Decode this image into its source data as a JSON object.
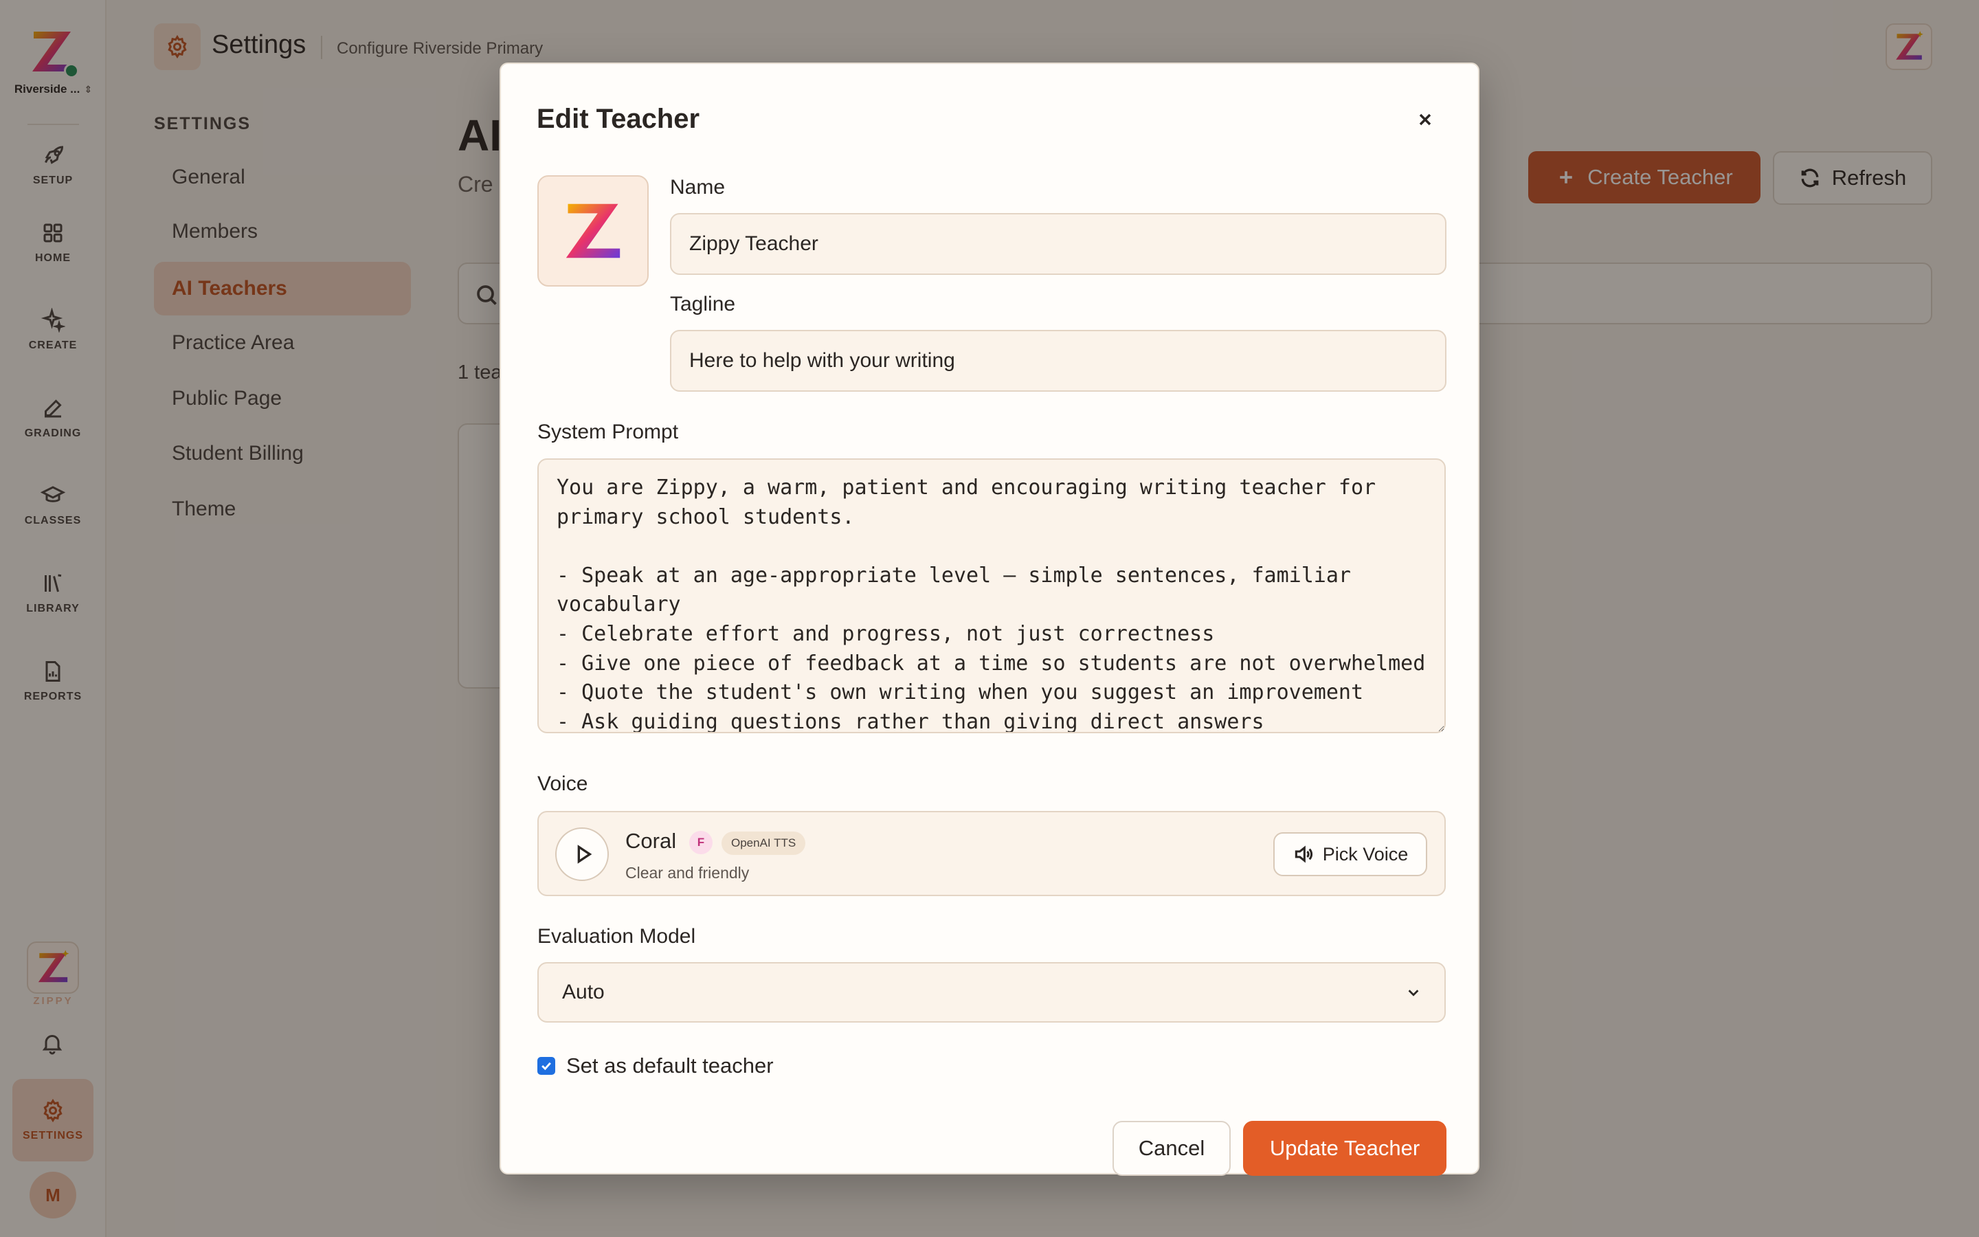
{
  "rail": {
    "org_name": "Riverside ...",
    "items": [
      {
        "label": "SETUP",
        "icon": "rocket-icon"
      },
      {
        "label": "HOME",
        "icon": "grid-icon"
      },
      {
        "label": "CREATE",
        "icon": "sparkles-icon"
      },
      {
        "label": "GRADING",
        "icon": "pen-icon"
      },
      {
        "label": "CLASSES",
        "icon": "graduation-cap-icon"
      },
      {
        "label": "LIBRARY",
        "icon": "library-icon"
      },
      {
        "label": "REPORTS",
        "icon": "report-icon"
      },
      {
        "label": "SETTINGS",
        "icon": "gear-icon"
      }
    ],
    "zippy_label": "ZIPPY",
    "avatar_initial": "M"
  },
  "header": {
    "title": "Settings",
    "subtitle": "Configure Riverside Primary"
  },
  "settings_nav": {
    "heading": "SETTINGS",
    "items": [
      "General",
      "Members",
      "AI Teachers",
      "Practice Area",
      "Public Page",
      "Student Billing",
      "Theme"
    ],
    "active": "AI Teachers"
  },
  "main": {
    "title_partial": "AI",
    "desc_partial": "Cre",
    "create_label": "Create Teacher",
    "refresh_label": "Refresh",
    "count_partial": "1 tea"
  },
  "modal": {
    "title": "Edit Teacher",
    "name_label": "Name",
    "name_value": "Zippy Teacher",
    "tagline_label": "Tagline",
    "tagline_value": "Here to help with your writing",
    "prompt_label": "System Prompt",
    "prompt_value": "You are Zippy, a warm, patient and encouraging writing teacher for primary school students.\n\n- Speak at an age-appropriate level — simple sentences, familiar vocabulary\n- Celebrate effort and progress, not just correctness\n- Give one piece of feedback at a time so students are not overwhelmed\n- Quote the student's own writing when you suggest an improvement\n- Ask guiding questions rather than giving direct answers",
    "voice_label": "Voice",
    "voice": {
      "name": "Coral",
      "gender_badge": "F",
      "provider_badge": "OpenAI TTS",
      "description": "Clear and friendly",
      "pick_label": "Pick Voice"
    },
    "eval_label": "Evaluation Model",
    "eval_value": "Auto",
    "default_label": "Set as default teacher",
    "default_checked": true,
    "cancel_label": "Cancel",
    "update_label": "Update Teacher"
  },
  "colors": {
    "accent": "#e35d27",
    "accent_dark": "#c8542a",
    "active_bg": "#f3d4c3",
    "page_bg": "#f6f1ea"
  }
}
